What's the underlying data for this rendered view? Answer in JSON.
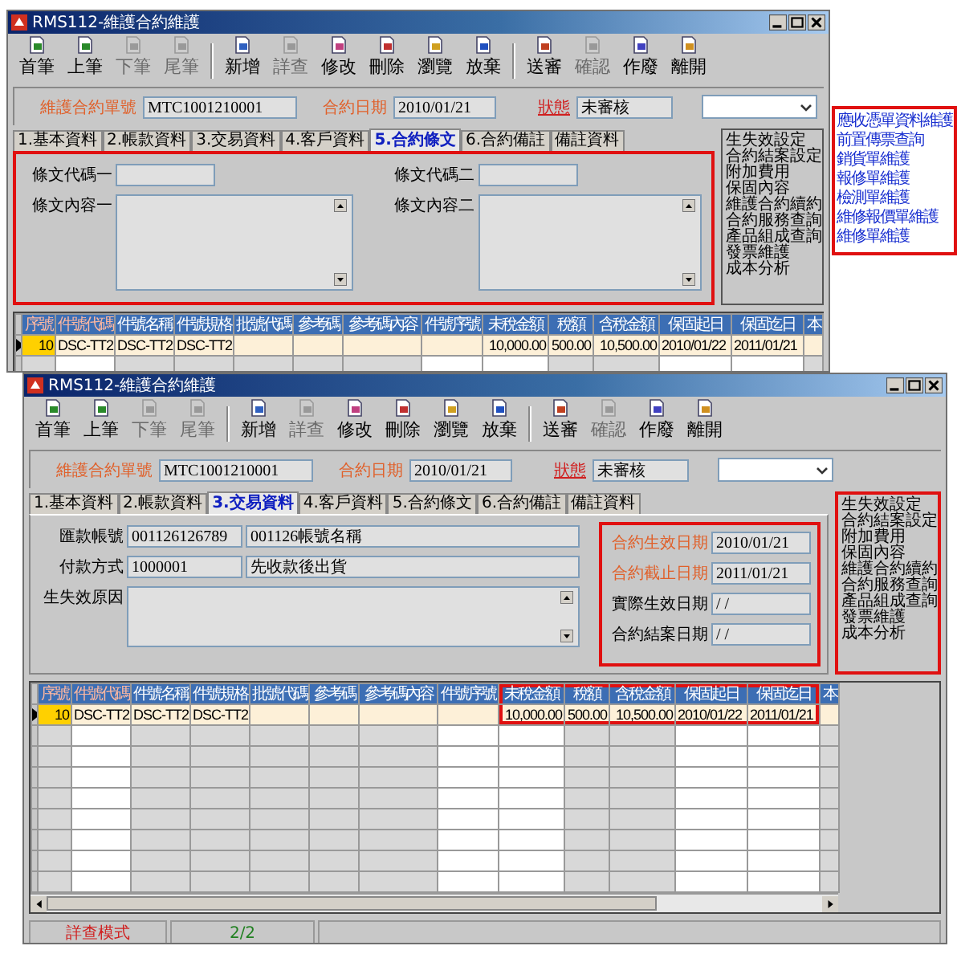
{
  "windows": [
    {
      "title": "RMS112-維護合約維護",
      "toolbar": [
        [
          {
            "label": "首筆",
            "disabled": false
          },
          {
            "label": "上筆",
            "disabled": false
          },
          {
            "label": "下筆",
            "disabled": true
          },
          {
            "label": "尾筆",
            "disabled": true
          }
        ],
        [
          {
            "label": "新增",
            "disabled": false
          },
          {
            "label": "詳查",
            "disabled": true
          },
          {
            "label": "修改",
            "disabled": false
          },
          {
            "label": "刪除",
            "disabled": false
          },
          {
            "label": "瀏覽",
            "disabled": false
          },
          {
            "label": "放棄",
            "disabled": false
          }
        ],
        [
          {
            "label": "送審",
            "disabled": false
          },
          {
            "label": "確認",
            "disabled": true
          },
          {
            "label": "作廢",
            "disabled": false
          },
          {
            "label": "離開",
            "disabled": false
          }
        ]
      ],
      "header": {
        "number_label": "維護合約單號",
        "number": "MTC1001210001",
        "date_label": "合約日期",
        "date": "2010/01/21",
        "status_label": "狀態",
        "status": "未審核"
      },
      "tabs": [
        {
          "label": "1.基本資料",
          "selected": false
        },
        {
          "label": "2.帳款資料",
          "selected": false
        },
        {
          "label": "3.交易資料",
          "selected": false
        },
        {
          "label": "4.客戶資料",
          "selected": false
        },
        {
          "label": "5.合約條文",
          "selected": true
        },
        {
          "label": "6.合約備註",
          "selected": false
        },
        {
          "label": "備註資料",
          "selected": false
        }
      ],
      "panel": {
        "kind": "terms",
        "highlighted": true,
        "groups": [
          {
            "highlighted": false,
            "fields": [
              {
                "label": "條文代碼一",
                "kind": "input",
                "emphasized": false
              },
              {
                "label": "條文內容一",
                "kind": "textarea",
                "emphasized": false
              }
            ]
          },
          {
            "highlighted": false,
            "fields": [
              {
                "label": "條文代碼二",
                "kind": "input",
                "emphasized": false
              },
              {
                "label": "條文內容二",
                "kind": "textarea",
                "emphasized": false
              }
            ]
          }
        ]
      },
      "side_list": {
        "highlighted": false,
        "items": [
          "生失效設定",
          "合約結案設定",
          "附加費用",
          "保固內容",
          "維護合約續約",
          "合約服務查詢",
          "產品組成查詢",
          "發票維護",
          "成本分析"
        ]
      },
      "grid": {
        "columns": [
          {
            "label": "序號",
            "key": true,
            "readonly": true,
            "highlighted": false
          },
          {
            "label": "件號代碼",
            "key": true,
            "readonly": false,
            "highlighted": false
          },
          {
            "label": "件號名稱",
            "key": false,
            "readonly": true,
            "highlighted": false
          },
          {
            "label": "件號規格",
            "key": false,
            "readonly": true,
            "highlighted": false
          },
          {
            "label": "批號代碼",
            "key": false,
            "readonly": true,
            "highlighted": false
          },
          {
            "label": "參考碼",
            "key": false,
            "readonly": true,
            "highlighted": false
          },
          {
            "label": "參考碼內容",
            "key": false,
            "readonly": true,
            "highlighted": false
          },
          {
            "label": "件號序號",
            "key": false,
            "readonly": false,
            "highlighted": false
          },
          {
            "label": "未稅金額",
            "key": false,
            "readonly": false,
            "highlighted": false
          },
          {
            "label": "稅額",
            "key": false,
            "readonly": true,
            "highlighted": false
          },
          {
            "label": "含稅金額",
            "key": false,
            "readonly": true,
            "highlighted": false
          },
          {
            "label": "保固起日",
            "key": false,
            "readonly": false,
            "highlighted": false
          },
          {
            "label": "保固迄日",
            "key": false,
            "readonly": false,
            "highlighted": false
          },
          {
            "label": "本",
            "key": false,
            "readonly": true,
            "highlighted": false
          }
        ],
        "rows": [
          {
            "selected": true,
            "cells": [
              "10",
              "DSC-TT2",
              "DSC-TT2",
              "DSC-TT2",
              null,
              null,
              null,
              null,
              "10,000.00",
              "500.00",
              "10,500.00",
              "2010/01/22",
              "2011/01/21",
              null
            ]
          }
        ]
      }
    },
    {
      "title": "RMS112-維護合約維護",
      "toolbar": [
        [
          {
            "label": "首筆",
            "disabled": false
          },
          {
            "label": "上筆",
            "disabled": false
          },
          {
            "label": "下筆",
            "disabled": true
          },
          {
            "label": "尾筆",
            "disabled": true
          }
        ],
        [
          {
            "label": "新增",
            "disabled": false
          },
          {
            "label": "詳查",
            "disabled": true
          },
          {
            "label": "修改",
            "disabled": false
          },
          {
            "label": "刪除",
            "disabled": false
          },
          {
            "label": "瀏覽",
            "disabled": false
          },
          {
            "label": "放棄",
            "disabled": false
          }
        ],
        [
          {
            "label": "送審",
            "disabled": false
          },
          {
            "label": "確認",
            "disabled": true
          },
          {
            "label": "作廢",
            "disabled": false
          },
          {
            "label": "離開",
            "disabled": false
          }
        ]
      ],
      "header": {
        "number_label": "維護合約單號",
        "number": "MTC1001210001",
        "date_label": "合約日期",
        "date": "2010/01/21",
        "status_label": "狀態",
        "status": "未審核"
      },
      "tabs": [
        {
          "label": "1.基本資料",
          "selected": false
        },
        {
          "label": "2.帳款資料",
          "selected": false
        },
        {
          "label": "3.交易資料",
          "selected": true
        },
        {
          "label": "4.客戶資料",
          "selected": false
        },
        {
          "label": "5.合約條文",
          "selected": false
        },
        {
          "label": "6.合約備註",
          "selected": false
        },
        {
          "label": "備註資料",
          "selected": false
        }
      ],
      "panel": {
        "kind": "trade",
        "highlighted": false,
        "groups": [
          {
            "highlighted": false,
            "fields": [
              {
                "label": "匯款帳號",
                "kind": "input",
                "emphasized": false,
                "values": [
                  "001126126789",
                  "001126帳號名稱"
                ]
              },
              {
                "label": "付款方式",
                "kind": "input",
                "emphasized": false,
                "values": [
                  "1000001",
                  "先收款後出貨"
                ]
              },
              {
                "label": "生失效原因",
                "kind": "textarea",
                "emphasized": false
              }
            ]
          },
          {
            "highlighted": true,
            "fields": [
              {
                "label": "合約生效日期",
                "kind": "input",
                "emphasized": true,
                "values": [
                  "2010/01/21"
                ]
              },
              {
                "label": "合約截止日期",
                "kind": "input",
                "emphasized": true,
                "values": [
                  "2011/01/21"
                ]
              },
              {
                "label": "實際生效日期",
                "kind": "input",
                "emphasized": false,
                "values": [
                  "/   /"
                ]
              },
              {
                "label": "合約結案日期",
                "kind": "input",
                "emphasized": false,
                "values": [
                  "/   /"
                ]
              }
            ]
          }
        ]
      },
      "side_list": {
        "highlighted": true,
        "items": [
          "生失效設定",
          "合約結案設定",
          "附加費用",
          "保固內容",
          "維護合約續約",
          "合約服務查詢",
          "產品組成查詢",
          "發票維護",
          "成本分析"
        ]
      },
      "grid": {
        "columns": [
          {
            "label": "序號",
            "key": true,
            "readonly": true,
            "highlighted": false
          },
          {
            "label": "件號代碼",
            "key": true,
            "readonly": false,
            "highlighted": false
          },
          {
            "label": "件號名稱",
            "key": false,
            "readonly": true,
            "highlighted": false
          },
          {
            "label": "件號規格",
            "key": false,
            "readonly": true,
            "highlighted": false
          },
          {
            "label": "批號代碼",
            "key": false,
            "readonly": true,
            "highlighted": false
          },
          {
            "label": "參考碼",
            "key": false,
            "readonly": true,
            "highlighted": false
          },
          {
            "label": "參考碼內容",
            "key": false,
            "readonly": true,
            "highlighted": false
          },
          {
            "label": "件號序號",
            "key": false,
            "readonly": false,
            "highlighted": false
          },
          {
            "label": "未稅金額",
            "key": false,
            "readonly": false,
            "highlighted": true
          },
          {
            "label": "稅額",
            "key": false,
            "readonly": true,
            "highlighted": true
          },
          {
            "label": "含稅金額",
            "key": false,
            "readonly": true,
            "highlighted": true
          },
          {
            "label": "保固起日",
            "key": false,
            "readonly": false,
            "highlighted": true
          },
          {
            "label": "保固迄日",
            "key": false,
            "readonly": false,
            "highlighted": true
          },
          {
            "label": "本",
            "key": false,
            "readonly": true,
            "highlighted": false
          }
        ],
        "rows": [
          {
            "selected": true,
            "cells": [
              "10",
              "DSC-TT2",
              "DSC-TT2",
              "DSC-TT2",
              null,
              null,
              null,
              null,
              "10,000.00",
              "500.00",
              "10,500.00",
              "2010/01/22",
              "2011/01/21",
              null
            ]
          }
        ]
      },
      "status_bar": [
        {
          "kind": "mode",
          "text": "詳查模式"
        },
        {
          "kind": "count",
          "text": "2/2"
        }
      ]
    }
  ],
  "popup_menu": {
    "items": [
      "應收憑單資料維護",
      "前置傳票查詢",
      "銷貨單維護",
      "報修單維護",
      "檢測單維護",
      "維修報價單維護",
      "維修單維護"
    ]
  }
}
